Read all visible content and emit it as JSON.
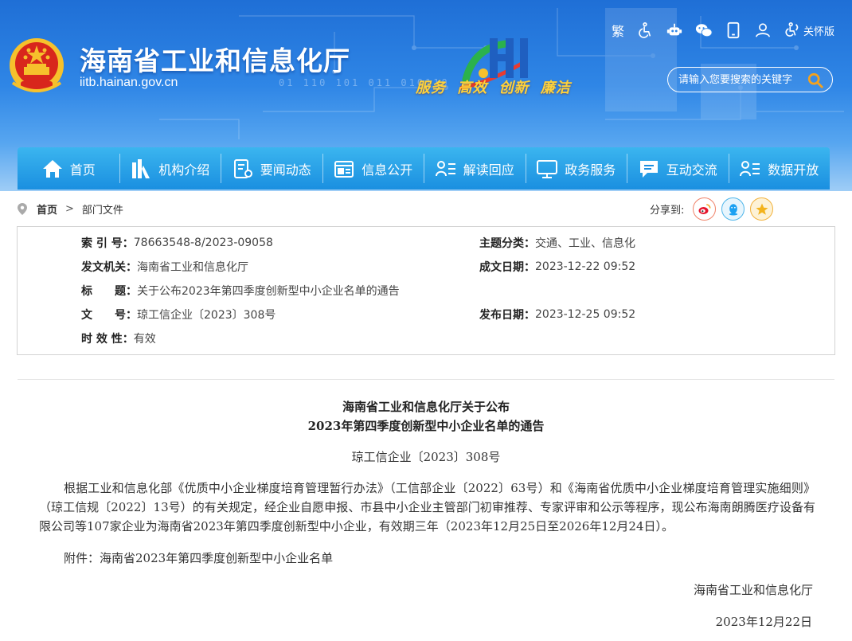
{
  "header": {
    "site_title": "海南省工业和信息化厅",
    "site_domain": "iitb.hainan.gov.cn",
    "binary_text": "01 110 101 011 010110",
    "slogan": [
      "服务",
      "高效",
      "创新",
      "廉洁"
    ],
    "toolbar": {
      "traditional_label": "繁",
      "care_label": "关怀版"
    },
    "search": {
      "placeholder": "请输入您要搜索的关键字"
    }
  },
  "nav": {
    "items": [
      {
        "label": "首页",
        "icon": "home-icon"
      },
      {
        "label": "机构介绍",
        "icon": "organization-icon"
      },
      {
        "label": "要闻动态",
        "icon": "news-icon"
      },
      {
        "label": "信息公开",
        "icon": "disclosure-icon"
      },
      {
        "label": "解读回应",
        "icon": "interpretation-icon"
      },
      {
        "label": "政务服务",
        "icon": "monitor-icon"
      },
      {
        "label": "互动交流",
        "icon": "chat-icon"
      },
      {
        "label": "数据开放",
        "icon": "data-icon"
      }
    ]
  },
  "breadcrumb": {
    "home": "首页",
    "current": "部门文件"
  },
  "share": {
    "label": "分享到:"
  },
  "meta": {
    "index_key": "索 引 号：",
    "index_val": "78663548-8/2023-09058",
    "topic_key": "主题分类：",
    "topic_val": "交通、工业、信息化",
    "issuer_key": "发文机关：",
    "issuer_val": "海南省工业和信息化厅",
    "created_key": "成文日期：",
    "created_val": "2023-12-22 09:52",
    "title_key": "标　　题：",
    "title_val": "关于公布2023年第四季度创新型中小企业名单的通告",
    "docno_key": "文　　号：",
    "docno_val": "琼工信企业〔2023〕308号",
    "published_key": "发布日期：",
    "published_val": "2023-12-25 09:52",
    "validity_key": "时 效 性：",
    "validity_val": "有效"
  },
  "article": {
    "title_line1": "海南省工业和信息化厅关于公布",
    "title_line2": "2023年第四季度创新型中小企业名单的通告",
    "doc_no": "琼工信企业〔2023〕308号",
    "body": "根据工业和信息化部《优质中小企业梯度培育管理暂行办法》（工信部企业〔2022〕63号）和《海南省优质中小企业梯度培育管理实施细则》（琼工信规〔2022〕13号）的有关规定，经企业自愿申报、市县中小企业主管部门初审推荐、专家评审和公示等程序，现公布海南朗腾医疗设备有限公司等107家企业为海南省2023年第四季度创新型中小企业，有效期三年（2023年12月25日至2026年12月24日）。",
    "attachment": "附件：海南省2023年第四季度创新型中小企业名单",
    "signature": "海南省工业和信息化厅",
    "date": "2023年12月22日"
  },
  "colors": {
    "header_blue": "#1f6fd6",
    "nav_blue": "#1a8fe0",
    "slogan_gold": "#ffd23a",
    "emblem_red": "#d8261c",
    "emblem_gold": "#f6c12c"
  }
}
